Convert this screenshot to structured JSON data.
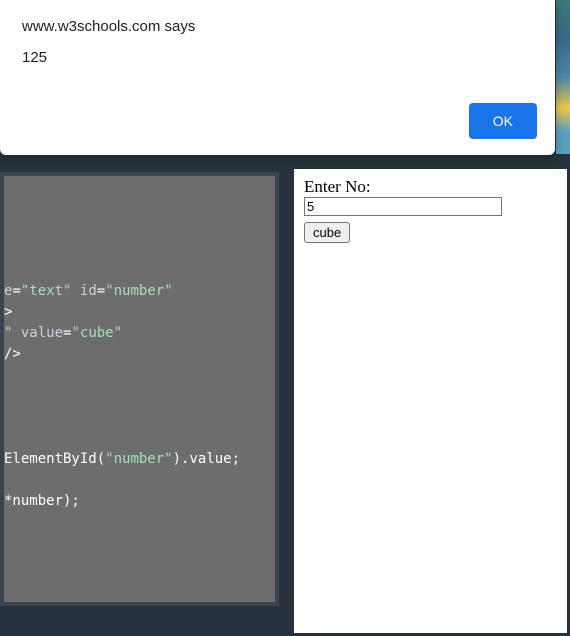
{
  "alert": {
    "title": "www.w3schools.com says",
    "message": "125",
    "ok_label": "OK"
  },
  "editor": {
    "lines": [
      {
        "type": "attr",
        "segments": [
          {
            "t": "e",
            "c": "attr"
          },
          {
            "t": "=",
            "c": "punct"
          },
          {
            "t": "\"text\"",
            "c": "str"
          },
          {
            "t": " ",
            "c": "punct"
          },
          {
            "t": "id",
            "c": "attr"
          },
          {
            "t": "=",
            "c": "punct"
          },
          {
            "t": "\"number\"",
            "c": "str"
          }
        ]
      },
      {
        "type": "plain",
        "text": ">"
      },
      {
        "type": "attr",
        "segments": [
          {
            "t": "\"",
            "c": "str"
          },
          {
            "t": " ",
            "c": "punct"
          },
          {
            "t": "value",
            "c": "attr"
          },
          {
            "t": "=",
            "c": "punct"
          },
          {
            "t": "\"cube\"",
            "c": "str"
          }
        ]
      },
      {
        "type": "plain",
        "text": "/>"
      },
      {
        "type": "blank"
      },
      {
        "type": "blank"
      },
      {
        "type": "blank"
      },
      {
        "type": "blank"
      },
      {
        "type": "code1",
        "pre": "ElementById(",
        "mid": "\"number\"",
        "post": ").value;"
      },
      {
        "type": "blank"
      },
      {
        "type": "plain",
        "text": "*number);"
      }
    ]
  },
  "result": {
    "label": "Enter No:",
    "input_value": "5",
    "button_label": "cube"
  }
}
